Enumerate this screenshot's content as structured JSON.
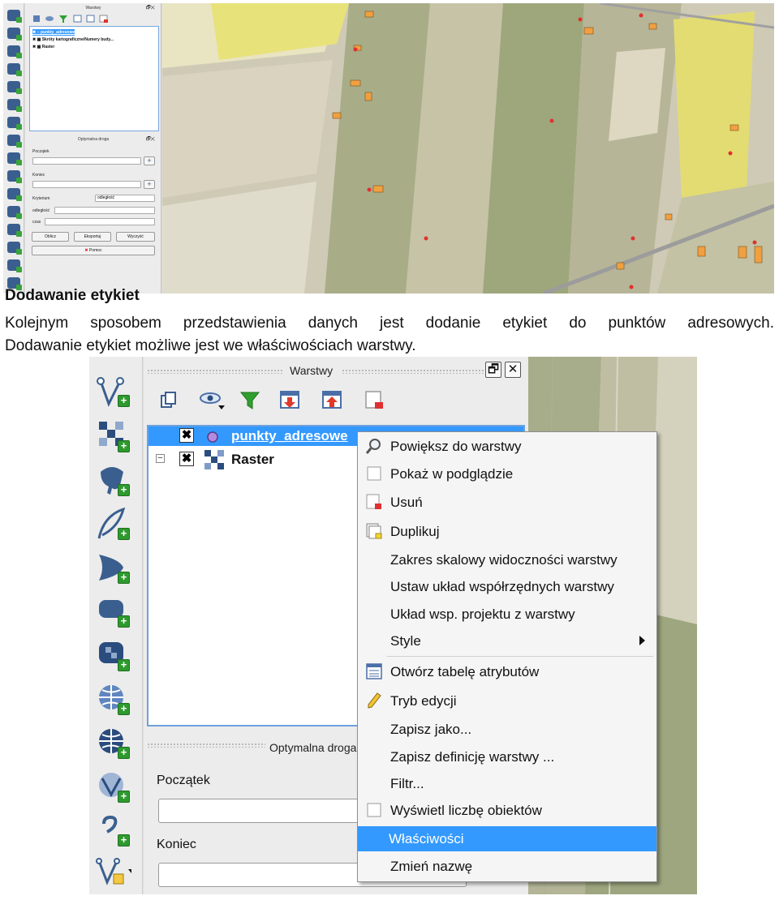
{
  "top_screenshot": {
    "layers_panel_title": "Warstwy",
    "window_buttons": "🗗✕",
    "layers": [
      {
        "name": "punkty_adresowe",
        "checked": "✖",
        "selected": true
      },
      {
        "name": "Skróty kartograficzne/Numery budy...",
        "checked": "✖",
        "selected": false
      },
      {
        "name": "Raster",
        "checked": "✖",
        "selected": false
      }
    ],
    "route_panel_title": "Optymalna droga",
    "start_label": "Początek",
    "end_label": "Koniec",
    "criterion_label": "Kryterium",
    "criterion_value": "odległość",
    "distance_label": "odległość",
    "time_label": "czas",
    "buttons": {
      "calculate": "Oblicz",
      "export": "Eksportuj",
      "clear": "Wyczyść",
      "help": "Pomoc"
    }
  },
  "heading": "Dodawanie etykiet",
  "paragraph": {
    "line1": "Kolejnym sposobem przedstawienia danych jest dodanie etykiet do punktów adresowych.",
    "line2": "Dodawanie etykiet możliwe jest we właściwościach warstwy."
  },
  "bottom_screenshot": {
    "layers_panel_title": "Warstwy",
    "layers": [
      {
        "name": "punkty_adresowe",
        "checked": "✖",
        "selected": true
      },
      {
        "name": "Raster",
        "checked": "✖",
        "selected": false
      }
    ],
    "expander": "−",
    "route_panel_title": "Optymalna droga",
    "start_label": "Początek",
    "end_label": "Koniec",
    "context_menu": {
      "items": [
        {
          "label": "Powiększ do warstwy",
          "icon": "zoom-icon"
        },
        {
          "label": "Pokaż w podglądzie",
          "icon": "checkbox-icon"
        },
        {
          "label": "Usuń",
          "icon": "remove-layer-icon"
        },
        {
          "label": "Duplikuj",
          "icon": "duplicate-icon"
        },
        {
          "label": "Zakres skalowy widoczności warstwy",
          "icon": ""
        },
        {
          "label": "Ustaw układ współrzędnych warstwy",
          "icon": ""
        },
        {
          "label": "Układ wsp. projektu z warstwy",
          "icon": ""
        },
        {
          "label": "Style",
          "icon": "",
          "submenu": true
        },
        {
          "label": "Otwórz tabelę atrybutów",
          "icon": "table-icon"
        },
        {
          "label": "Tryb edycji",
          "icon": "pencil-icon"
        },
        {
          "label": "Zapisz jako...",
          "icon": ""
        },
        {
          "label": "Zapisz definicję warstwy ...",
          "icon": ""
        },
        {
          "label": "Filtr...",
          "icon": ""
        },
        {
          "label": "Wyświetl liczbę obiektów",
          "icon": "checkbox-icon"
        },
        {
          "label": "Właściwości",
          "icon": "",
          "highlighted": true
        },
        {
          "label": "Zmień nazwę",
          "icon": ""
        }
      ]
    }
  },
  "colors": {
    "selection": "#3399ff",
    "add_green": "#2e9a2e",
    "qgis_blue": "#3a5f8f"
  }
}
